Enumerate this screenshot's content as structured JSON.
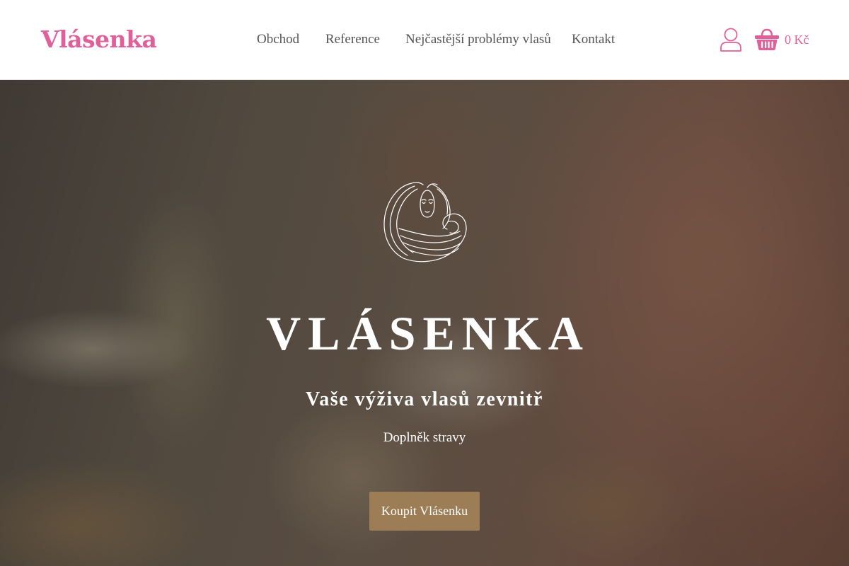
{
  "header": {
    "logo_text": "Vlásenka",
    "nav": [
      {
        "label": "Obchod"
      },
      {
        "label": "Reference"
      },
      {
        "label": "Nejčastější problémy vlasů"
      },
      {
        "label": "Kontakt"
      }
    ],
    "account_icon": "user-icon",
    "cart_icon": "shopping-basket-icon",
    "cart_total": "0 Kč"
  },
  "hero": {
    "emblem_icon": "woman-flowing-hair-icon",
    "title": "VLÁSENKA",
    "subtitle": "Vaše výživa vlasů zevnitř",
    "category": "Doplněk stravy",
    "cta_label": "Koupit Vlásenku"
  },
  "colors": {
    "brand_pink": "#e0609a",
    "nav_text": "#545454",
    "cta_background": "#9c7d55",
    "cta_text": "#ffffff",
    "hero_text": "#ffffff"
  }
}
